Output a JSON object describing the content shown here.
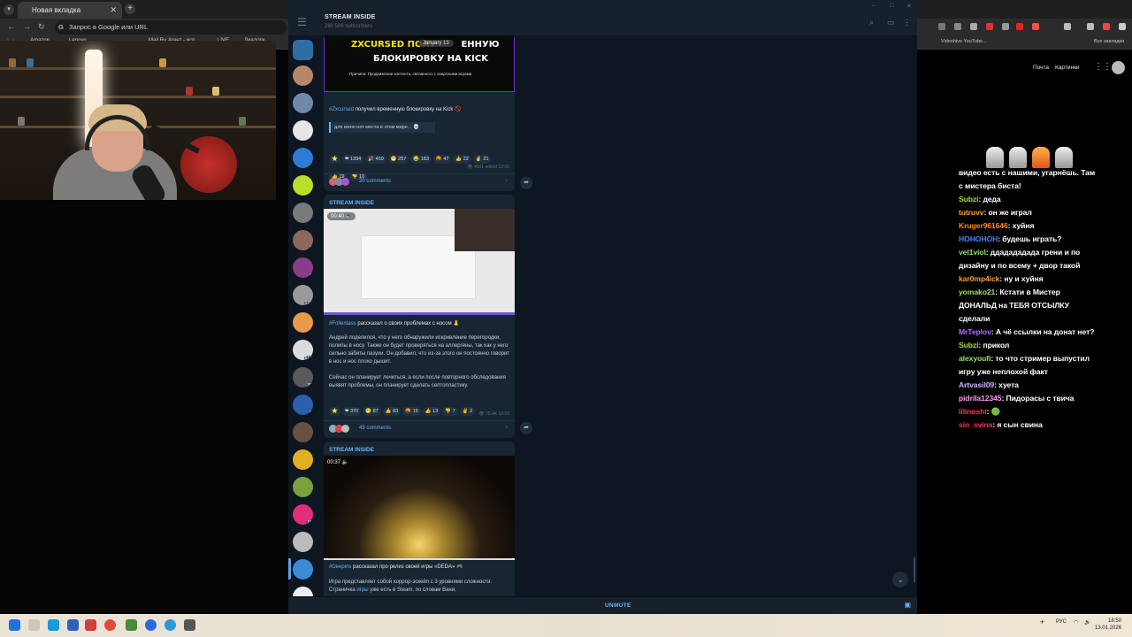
{
  "browser_left": {
    "tab_title": "Новая вкладка",
    "tab_close": "✕",
    "new_tab": "+",
    "omnibox_text": "Запрос в Google или URL",
    "bookmarks": [
      "Amazon",
      "Lenovo",
      "Mail.Ru Агент - исп...",
      "LIVE",
      "Диалоги"
    ]
  },
  "browser_right": {
    "bookmarks": [
      "Videohive YouTube...",
      "Все закладки"
    ],
    "google_links": [
      "Почта",
      "Картинки"
    ]
  },
  "telegram": {
    "channel_title": "STREAM INSIDE",
    "subscribers": "260 586 subscribers",
    "unmute_label": "UNMUTE",
    "posts": [
      {
        "banner_line1": "ZXCURSED ПОЛУ",
        "banner_line1b": "ЕННУЮ",
        "banner_date": "January 13",
        "banner_line2": "БЛОКИРОВКУ НА KICK",
        "banner_reason": "Причина: Продвижение контента, связанного с азартными играми.",
        "hashtag": "#Zxcursed",
        "text": "получил временную блокировку на Kick 🚫",
        "quote": "для меня нет места в этом мире... 💀",
        "reactions": [
          "⭐",
          "❤ 1394",
          "🎉 450",
          "😁 257",
          "😂 183",
          "🤬 47",
          "👍 22",
          "✌ 21",
          "👍 19",
          "👎 10"
        ],
        "meta": "👁 4601  edited 12:05",
        "comments": "20 comments"
      },
      {
        "channel": "STREAM INSIDE",
        "video_time": "00:40",
        "hashtag": "#Follentass",
        "text": "рассказал о своих проблемах с носом 👃",
        "body1": "Андрей поделился, что у него обнаружили искривление перегородки, полипы в носу. Также он будет проверяться на аллергены, так как у него сильно забиты пазухи. Он добавил, что из-за этого он постоянно говорит в нос и нос плохо дышит.",
        "body2": "Сейчас он планирует лечиться, а если после повторного обследования выявят проблемы, он планирует сделать септопластику.",
        "reactions": [
          "⭐",
          "❤ 370",
          "😁 87",
          "👍 83",
          "🤬 19",
          "👍 13",
          "👎 7",
          "✌ 2"
        ],
        "meta": "👁 75.4K  12:53",
        "comments": "49 comments"
      },
      {
        "channel": "STREAM INSIDE",
        "video_time": "00:37",
        "hashtag": "#Deepins",
        "text": "рассказал про релиз своей игры «DEDA» 🎮",
        "body1": "Игра представляет собой хоррор-эскейп с 3 уровнями сложности. Страничка",
        "body1_link": "игры",
        "body1_tail": "уже есть в Steam, по словам Вани,"
      }
    ],
    "folder_badges": [
      "7",
      "9",
      "126",
      "517",
      "36",
      "6",
      "16",
      "1"
    ]
  },
  "chat": {
    "lines": [
      {
        "user": "",
        "color": "#ffffff",
        "text": "видео есть с нашими, угарнёшь. Там"
      },
      {
        "user": "",
        "color": "#ffffff",
        "text": "с мистера биста!"
      },
      {
        "user": "Subzi",
        "color": "#a6e22e",
        "text": "деда"
      },
      {
        "user": "tutruvv",
        "color": "#ff9f2e",
        "text": "он же играл"
      },
      {
        "user": "Kruger961646",
        "color": "#ff8c1a",
        "text": "хуйня"
      },
      {
        "user": "HOHOHOH",
        "color": "#3d8bff",
        "text": "будешь играть?"
      },
      {
        "user": "vel1viol",
        "color": "#9be15d",
        "text": "ддадададада грени и по"
      },
      {
        "user": "",
        "color": "#ffffff",
        "text": "дизайну и по всему + двор такой"
      },
      {
        "user": "kar0mp4ick",
        "color": "#ff9f2e",
        "text": "ну и хуйня"
      },
      {
        "user": "yomako21",
        "color": "#9be15d",
        "text": "Кстати в Мистер"
      },
      {
        "user": "",
        "color": "#ffffff",
        "text": "ДОНАЛЬД на ТЕБЯ ОТСЫЛКУ"
      },
      {
        "user": "",
        "color": "#ffffff",
        "text": "сделали"
      },
      {
        "user": "MrTeplov",
        "color": "#b36bff",
        "text": "А чё ссылки на донат нет?"
      },
      {
        "user": "Subzi",
        "color": "#a6e22e",
        "text": "прикол"
      },
      {
        "user": "alexyoufi",
        "color": "#9be15d",
        "text": "то что стример выпустил"
      },
      {
        "user": "",
        "color": "#ffffff",
        "text": "игру уже неплохой факт"
      },
      {
        "user": "Artvasil09",
        "color": "#c9b8ff",
        "text": "хуета"
      },
      {
        "user": "pidrila12345",
        "color": "#ff9ff3",
        "text": "Пидорасы с твича"
      },
      {
        "user": "lilinoshi",
        "color": "#ff2d55",
        "text": "🟢"
      },
      {
        "user": "sin_svina",
        "color": "#ff2d55",
        "text": "я сын свина"
      }
    ]
  },
  "taskbar": {
    "lang": "РУС",
    "time": "18:50",
    "date": "13.01.2026"
  }
}
